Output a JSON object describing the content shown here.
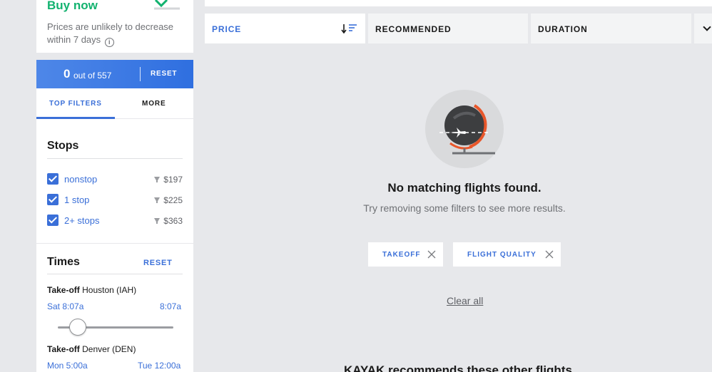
{
  "buy": {
    "title": "Buy now",
    "advice": "Prices are unlikely to decrease within 7 days"
  },
  "filter_bar": {
    "count": "0",
    "count_suffix": "out of 557",
    "reset": "RESET"
  },
  "tabs": [
    {
      "label": "TOP FILTERS",
      "active": true
    },
    {
      "label": "MORE",
      "active": false
    }
  ],
  "stops": {
    "title": "Stops",
    "items": [
      {
        "label": "nonstop",
        "price": "$197",
        "checked": true
      },
      {
        "label": "1 stop",
        "price": "$225",
        "checked": true
      },
      {
        "label": "2+ stops",
        "price": "$363",
        "checked": true
      }
    ]
  },
  "times": {
    "title": "Times",
    "reset": "RESET",
    "takeoff_houston": {
      "label": "Take-off",
      "place": "Houston (IAH)",
      "from": "Sat 8:07a",
      "to": "8:07a"
    },
    "takeoff_denver": {
      "label": "Take-off",
      "place": "Denver (DEN)",
      "from": "Mon 5:00a",
      "to": "Tue 12:00a"
    }
  },
  "sort": {
    "price": "PRICE",
    "recommended": "RECOMMENDED",
    "duration": "DURATION"
  },
  "empty_state": {
    "title": "No matching flights found.",
    "subtitle": "Try removing some filters to see more results."
  },
  "chips": [
    {
      "label": "TAKEOFF"
    },
    {
      "label": "FLIGHT QUALITY"
    }
  ],
  "clear_all": "Clear all",
  "recommends_heading": "KAYAK recommends these other flights",
  "colors": {
    "accent": "#3a6fd8",
    "buy_green": "#12b26f",
    "globe_orange": "#e8562a"
  }
}
